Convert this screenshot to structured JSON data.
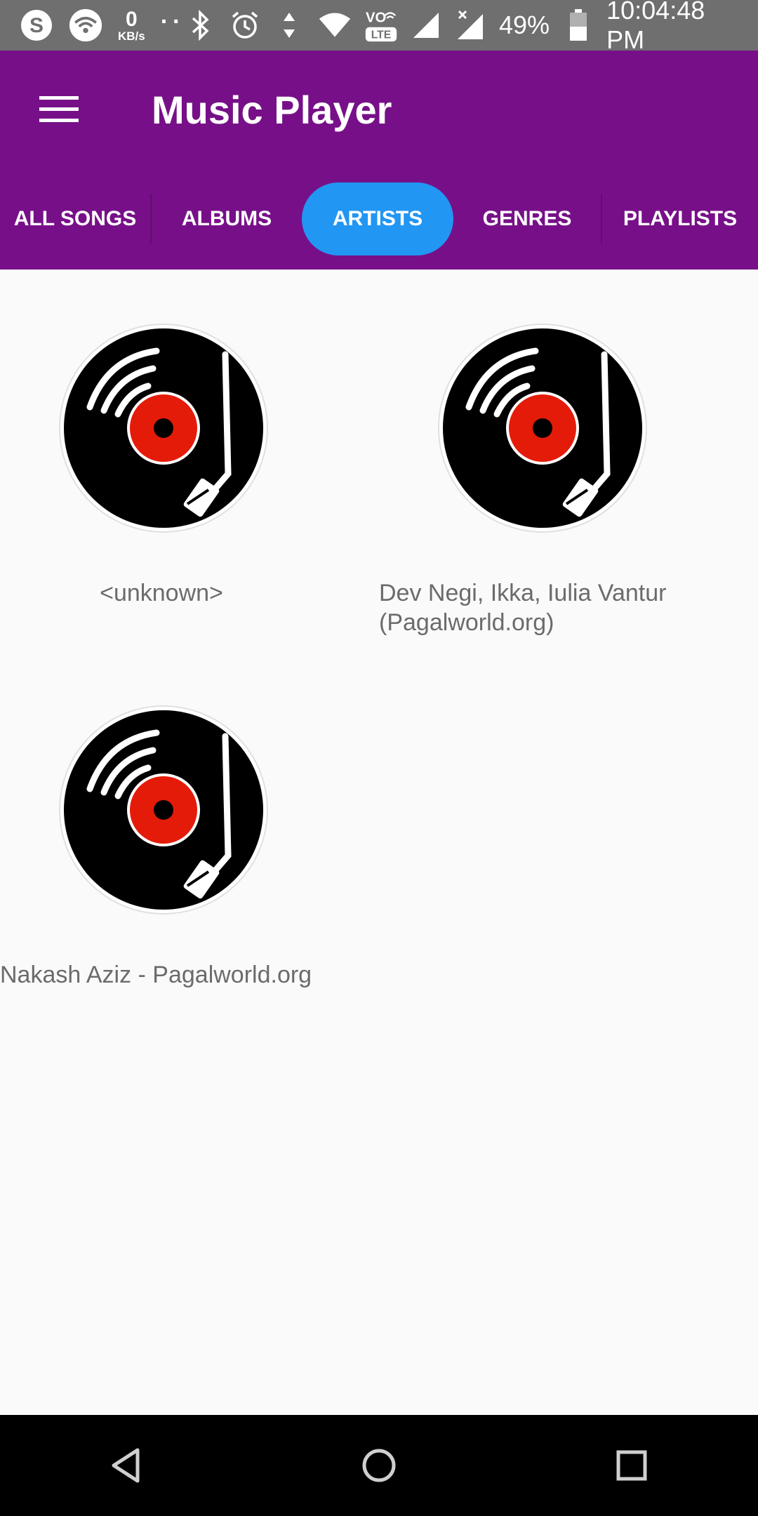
{
  "status_bar": {
    "speed_value": "0",
    "speed_unit": "KB/s",
    "dots": "··",
    "volte_top": "VO",
    "volte_bottom": "LTE",
    "battery": "49%",
    "time": "10:04:48 PM"
  },
  "app_bar": {
    "title": "Music Player"
  },
  "tabs": [
    {
      "label": "ALL SONGS",
      "active": false
    },
    {
      "label": "ALBUMS",
      "active": false
    },
    {
      "label": "ARTISTS",
      "active": true
    },
    {
      "label": "GENRES",
      "active": false
    },
    {
      "label": "PLAYLISTS",
      "active": false
    }
  ],
  "artists": [
    {
      "name_line1": "<unknown>",
      "name_line2": ""
    },
    {
      "name_line1": "Dev Negi, Ikka, Iulia Vantur",
      "name_line2": "(Pagalworld.org)"
    },
    {
      "name_line1": "Nakash Aziz - Pagalworld.org",
      "name_line2": ""
    }
  ],
  "colors": {
    "primary": "#771088",
    "accent": "#2196f3",
    "disc_label": "#e51b0a"
  }
}
